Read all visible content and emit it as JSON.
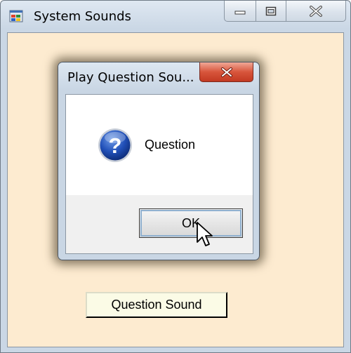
{
  "window": {
    "title": "System Sounds",
    "icon": "windows-app-icon",
    "caption_buttons": [
      "minimize-icon",
      "maximize-icon",
      "close-icon"
    ]
  },
  "main": {
    "button_label": "Question Sound",
    "background": "#fdebd0"
  },
  "dialog": {
    "title": "Play Question Sou...",
    "icon": "question-icon",
    "message": "Question",
    "ok_label": "OK",
    "close_icon": "close-icon",
    "close_color": "#c8432b"
  },
  "cursor": "arrow-pointer-icon"
}
